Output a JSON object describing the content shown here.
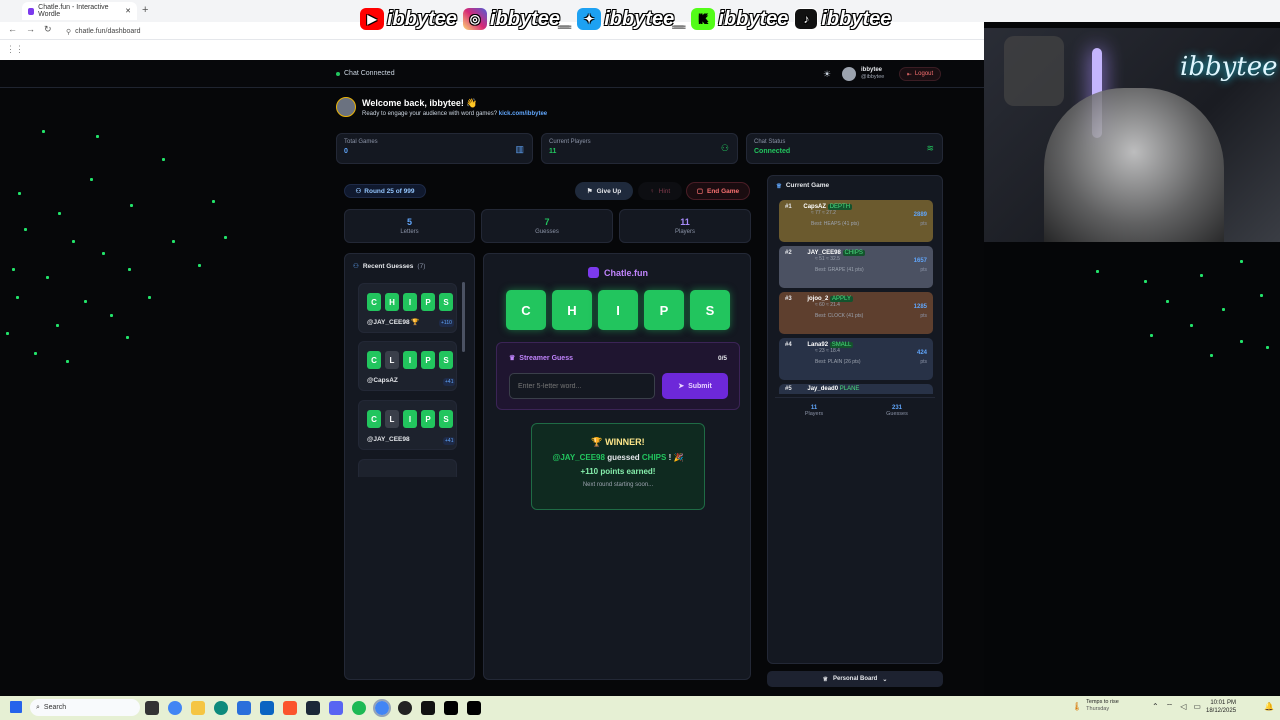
{
  "browser": {
    "tab_title": "Chatle.fun - Interactive Wordle",
    "url": "chatle.fun/dashboard"
  },
  "socials": [
    {
      "icon": "youtube-icon",
      "handle": "ibbytee",
      "color": "#ff0000"
    },
    {
      "icon": "instagram-icon",
      "handle": "ibbytee_",
      "color": "#d62976"
    },
    {
      "icon": "twitter-icon",
      "handle": "ibbytee_",
      "color": "#1da1f2"
    },
    {
      "icon": "kick-icon",
      "handle": "ibbytee",
      "color": "#53fc18"
    },
    {
      "icon": "tiktok-icon",
      "handle": "ibbytee",
      "color": "#111111"
    }
  ],
  "header": {
    "status": "Chat Connected",
    "user_name": "ibbytee",
    "user_handle": "@ibbytee",
    "logout": "Logout"
  },
  "welcome": {
    "title": "Welcome back, ibbytee! 👋",
    "subtitle": "Ready to engage your audience with word games?",
    "link": "kick.com/ibbytee"
  },
  "stats": [
    {
      "label": "Total Games",
      "value": "0"
    },
    {
      "label": "Current Players",
      "value": "11"
    },
    {
      "label": "Chat Status",
      "value": "Connected"
    }
  ],
  "round": {
    "label": "Round 25 of 999",
    "give_up": "Give Up",
    "hint": "Hint",
    "end_game": "End Game"
  },
  "counters": [
    {
      "value": "5",
      "label": "Letters"
    },
    {
      "value": "7",
      "label": "Guesses"
    },
    {
      "value": "11",
      "label": "Players"
    }
  ],
  "recent": {
    "title": "Recent Guesses",
    "count": "(7)",
    "items": [
      {
        "letters": [
          "C",
          "H",
          "I",
          "P",
          "S"
        ],
        "states": [
          "g",
          "g",
          "g",
          "g",
          "g"
        ],
        "user": "@JAY_CEE98 🏆",
        "points": "+110"
      },
      {
        "letters": [
          "C",
          "L",
          "I",
          "P",
          "S"
        ],
        "states": [
          "g",
          "x",
          "g",
          "g",
          "g"
        ],
        "user": "@CapsAZ",
        "points": "+41"
      },
      {
        "letters": [
          "C",
          "L",
          "I",
          "P",
          "S"
        ],
        "states": [
          "g",
          "x",
          "g",
          "g",
          "g"
        ],
        "user": "@JAY_CEE98",
        "points": "+41"
      }
    ]
  },
  "game": {
    "brand": "Chatle.fun",
    "tiles": [
      "C",
      "H",
      "I",
      "P",
      "S"
    ],
    "streamer_title": "Streamer Guess",
    "streamer_count": "0/5",
    "input_placeholder": "Enter 5-letter word...",
    "submit": "Submit",
    "winner_title": "WINNER!",
    "winner_user": "@JAY_CEE98",
    "winner_guessed": "guessed",
    "winner_word": "CHIPS",
    "winner_points": "+110 points earned!",
    "next_round": "Next round starting soon..."
  },
  "current_game": {
    "title": "Current Game",
    "leaders": [
      {
        "rank": "#1",
        "name": "CapsAZ",
        "tag": "DEPTH",
        "stats": "≈ 77 ≈ 27.2",
        "best": "Best: HEAPS (41 pts)",
        "points": "2889",
        "unit": "pts",
        "bg": "#6b5a2e"
      },
      {
        "rank": "#2",
        "name": "JAY_CEE98",
        "tag": "CHIPS",
        "stats": "≈ 51 ≈ 32.5",
        "best": "Best: GRAPE (41 pts)",
        "points": "1657",
        "unit": "pts",
        "bg": "#4b5162"
      },
      {
        "rank": "#3",
        "name": "jojoo_2",
        "tag": "APPLY",
        "stats": "≈ 60 ≈ 21.4",
        "best": "Best: CLOCK (41 pts)",
        "points": "1285",
        "unit": "pts",
        "bg": "#5e3f2e"
      },
      {
        "rank": "#4",
        "name": "Lana92",
        "tag": "SMALL",
        "stats": "≈ 23 ≈ 18.4",
        "best": "Best: PLAIN (26 pts)",
        "points": "424",
        "unit": "pts",
        "bg": "#283247"
      }
    ],
    "fifth_name": "Jay_dead0",
    "fifth_tag": "PLANE",
    "players_value": "11",
    "players_label": "Players",
    "guesses_value": "231",
    "guesses_label": "Guesses",
    "personal_board": "Personal Board"
  },
  "taskbar": {
    "search": "Search",
    "weather_title": "Temps to rise",
    "weather_sub": "Thursday",
    "time": "10:01 PM",
    "date": "18/12/2025"
  },
  "overlay": {
    "neon_text": "ibbytee"
  }
}
